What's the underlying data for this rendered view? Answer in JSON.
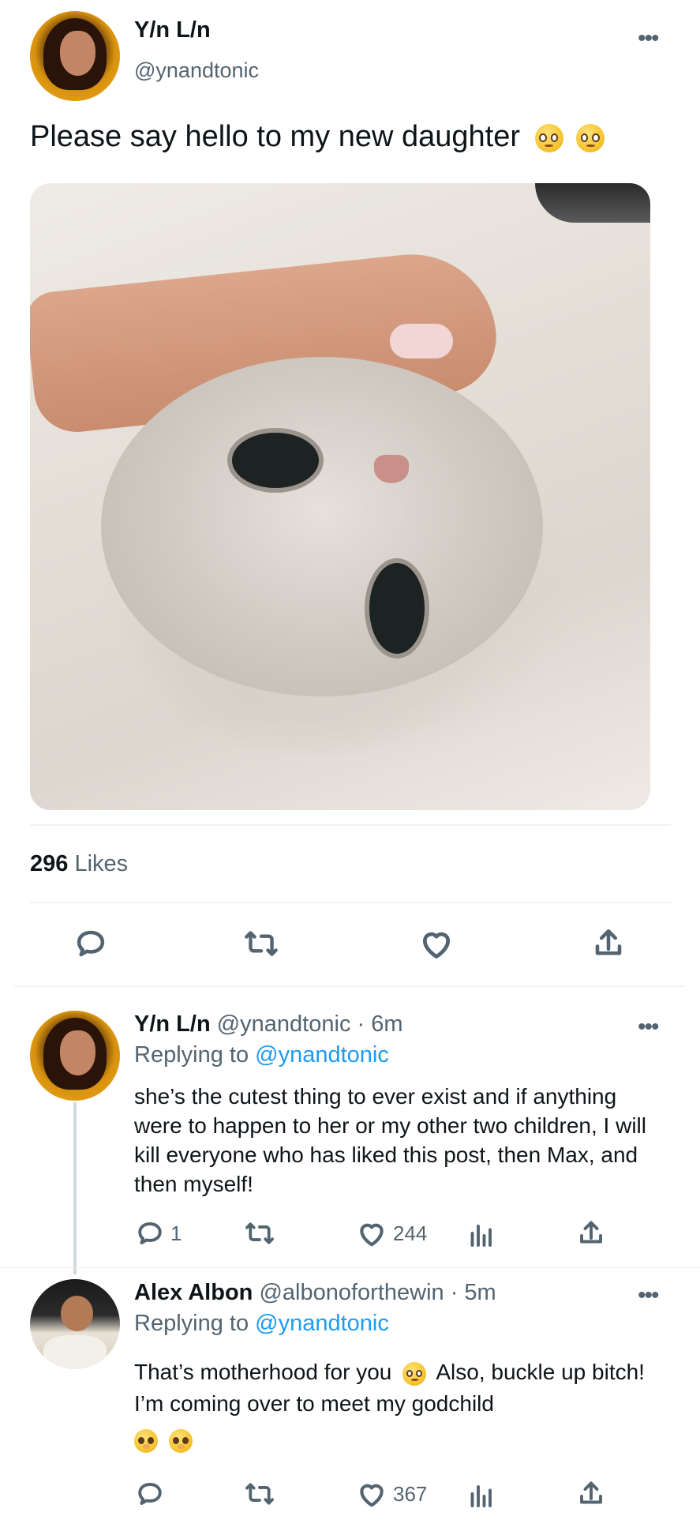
{
  "main_tweet": {
    "display_name": "Y/n L/n",
    "handle": "@ynandtonic",
    "text": "Please say hello to my new daughter",
    "emojis": [
      "pleading-face-emoji",
      "pleading-face-emoji"
    ],
    "likes_count": "296",
    "likes_label": "Likes"
  },
  "reply1": {
    "display_name": "Y/n L/n",
    "handle": "@ynandtonic",
    "time": "· 6m",
    "replying_prefix": "Replying to",
    "replying_handle": "@ynandtonic",
    "text": "she’s the cutest thing to ever exist and if anything were to happen to her or my other two children, I will kill everyone who has liked this post, then Max, and then myself!",
    "reply_count": "1",
    "like_count": "244"
  },
  "reply2": {
    "display_name": "Alex Albon",
    "handle": "@albonoforthewin",
    "time": "· 5m",
    "replying_prefix": "Replying to",
    "replying_handle": "@ynandtonic",
    "text_part1": "That’s motherhood for you",
    "text_part2": "Also, buckle up bitch! I’m coming over to meet my godchild",
    "like_count": "367"
  },
  "colors": {
    "text": "#0f1419",
    "muted": "#536471",
    "link": "#1d9bf0",
    "divider": "#eff3f4"
  }
}
